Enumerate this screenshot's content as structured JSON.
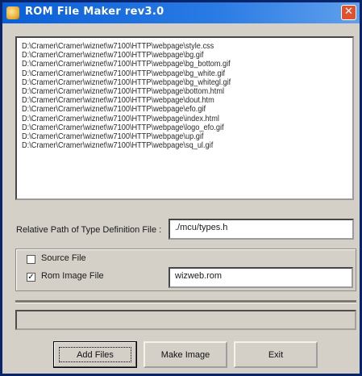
{
  "window": {
    "title": "ROM File Maker rev3.0",
    "close_glyph": "✕",
    "icon": "app-icon"
  },
  "files": [
    "D:\\Cramer\\Cramer\\wiznet\\w7100\\HTTP\\webpage\\style.css",
    "D:\\Cramer\\Cramer\\wiznet\\w7100\\HTTP\\webpage\\bg.gif",
    "D:\\Cramer\\Cramer\\wiznet\\w7100\\HTTP\\webpage\\bg_bottom.gif",
    "D:\\Cramer\\Cramer\\wiznet\\w7100\\HTTP\\webpage\\bg_white.gif",
    "D:\\Cramer\\Cramer\\wiznet\\w7100\\HTTP\\webpage\\bg_whitegl.gif",
    "D:\\Cramer\\Cramer\\wiznet\\w7100\\HTTP\\webpage\\bottom.html",
    "D:\\Cramer\\Cramer\\wiznet\\w7100\\HTTP\\webpage\\dout.htm",
    "D:\\Cramer\\Cramer\\wiznet\\w7100\\HTTP\\webpage\\efo.gif",
    "D:\\Cramer\\Cramer\\wiznet\\w7100\\HTTP\\webpage\\index.html",
    "D:\\Cramer\\Cramer\\wiznet\\w7100\\HTTP\\webpage\\logo_efo.gif",
    "D:\\Cramer\\Cramer\\wiznet\\w7100\\HTTP\\webpage\\up.gif",
    "D:\\Cramer\\Cramer\\wiznet\\w7100\\HTTP\\webpage\\sq_ul.gif"
  ],
  "relative_path": {
    "label": "Relative Path of Type Definition File :",
    "value": "./mcu/types.h"
  },
  "options": {
    "source_file": {
      "label": "Source File",
      "checked": false,
      "mark": ""
    },
    "rom_image_file": {
      "label": "Rom Image File",
      "checked": true,
      "mark": "✓"
    },
    "image_name": "wizweb.rom"
  },
  "buttons": {
    "add_files": "Add Files",
    "make_image": "Make Image",
    "exit": "Exit"
  },
  "colors": {
    "titlebar": "#0a5fd8",
    "face": "#d4d0c8",
    "close": "#e0522f"
  }
}
